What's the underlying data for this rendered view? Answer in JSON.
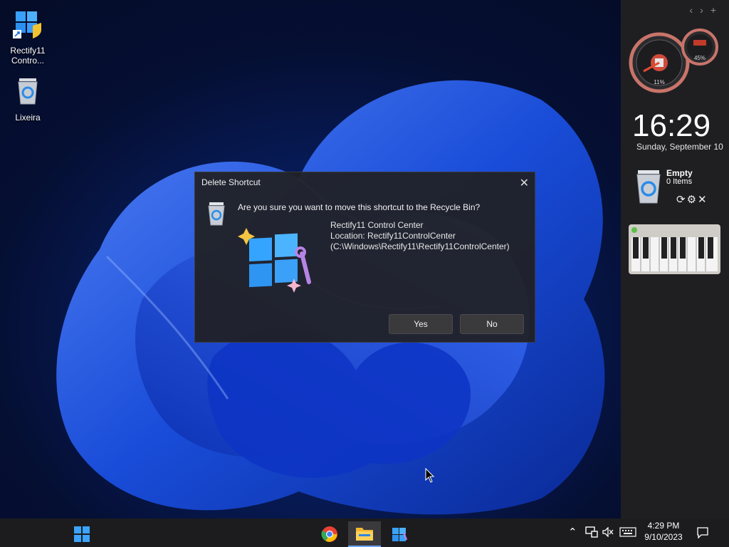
{
  "desktop": {
    "icons": [
      {
        "label": "Rectify11 Contro..."
      },
      {
        "label": "Lixeira"
      }
    ]
  },
  "sidebar": {
    "nav": {
      "prev": "‹",
      "next": "›",
      "add": "+"
    },
    "cpu_gadget": {
      "cpu_value": "11%",
      "mem_value": "45%"
    },
    "clock": {
      "time": "16:29",
      "date": "Sunday, September 10"
    },
    "recycle_gadget": {
      "title": "Empty",
      "count": "0 Items"
    }
  },
  "dialog": {
    "title": "Delete Shortcut",
    "question": "Are you sure you want to move this shortcut to the Recycle Bin?",
    "item_name": "Rectify11 Control Center",
    "item_location": "Location: Rectify11ControlCenter",
    "item_path": "(C:\\Windows\\Rectify11\\Rectify11ControlCenter)",
    "yes_label": "Yes",
    "no_label": "No"
  },
  "taskbar": {
    "time": "4:29 PM",
    "date": "9/10/2023"
  },
  "colors": {
    "accent": "#2f7cf6",
    "taskbar": "#1c1c1e",
    "dialog_bg": "#202022"
  }
}
